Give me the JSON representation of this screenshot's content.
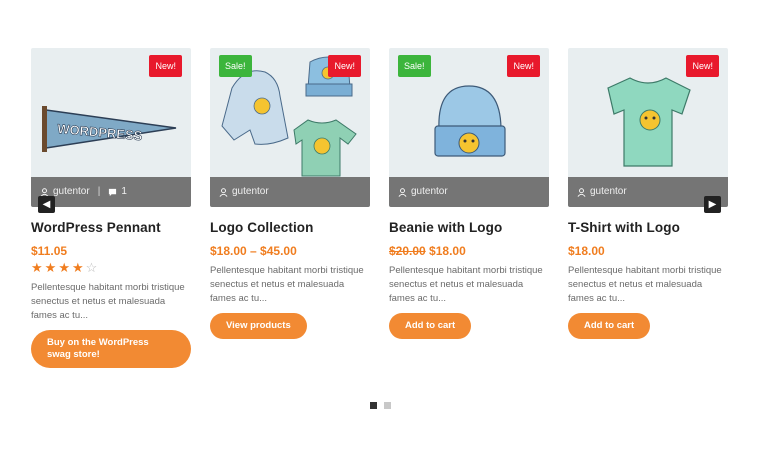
{
  "products": [
    {
      "title": "WordPress Pennant",
      "author": "gutentor",
      "comments": "1",
      "badge_new": "New!",
      "badge_sale": "",
      "price_old": "",
      "price": "$11.05",
      "rating": 4,
      "rating_max": 5,
      "description": "Pellentesque habitant morbi tristique senectus et netus et malesuada fames ac tu...",
      "button": "Buy on the WordPress swag store!"
    },
    {
      "title": "Logo Collection",
      "author": "gutentor",
      "badge_new": "New!",
      "badge_sale": "Sale!",
      "price_old": "",
      "price": "$18.00 – $45.00",
      "description": "Pellentesque habitant morbi tristique senectus et netus et malesuada fames ac tu...",
      "button": "View products"
    },
    {
      "title": "Beanie with Logo",
      "author": "gutentor",
      "badge_new": "New!",
      "badge_sale": "Sale!",
      "price_old": "$20.00",
      "price": "$18.00",
      "description": "Pellentesque habitant morbi tristique senectus et netus et malesuada fames ac tu...",
      "button": "Add to cart"
    },
    {
      "title": "T-Shirt with Logo",
      "author": "gutentor",
      "badge_new": "New!",
      "badge_sale": "",
      "price_old": "",
      "price": "$18.00",
      "description": "Pellentesque habitant morbi tristique senectus et netus et malesuada fames ac tu...",
      "button": "Add to cart"
    }
  ],
  "pennant_text": "WORDPRESS",
  "arrows": {
    "prev": "◀",
    "next": "▶"
  },
  "pagination": {
    "pages": 2,
    "active": 1
  },
  "colors": {
    "accent": "#f28a33",
    "price": "#f07d1f",
    "new_badge": "#e8192c",
    "sale_badge": "#3cb53c",
    "meta_bar": "#757575"
  },
  "icons": {
    "author": "user-icon",
    "comments": "comment-icon",
    "prev": "chevron-left-icon",
    "next": "chevron-right-icon"
  }
}
